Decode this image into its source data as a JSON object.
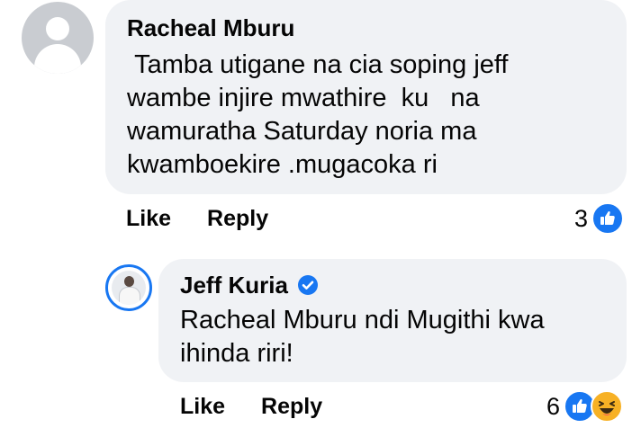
{
  "comments": [
    {
      "author": "Racheal Mburu",
      "text": " Tamba utigane na cia soping jeff\nwambe injire mwathire  ku   na\nwamuratha Saturday noria ma\nkwamboekire .mugacoka ri",
      "actions": {
        "like": "Like",
        "reply": "Reply"
      },
      "reactions": {
        "count": "3",
        "types": [
          "like-icon"
        ]
      }
    },
    {
      "author": "Jeff Kuria",
      "verified": true,
      "text": "Racheal Mburu ndi Mugithi kwa\nihinda riri!",
      "actions": {
        "like": "Like",
        "reply": "Reply"
      },
      "reactions": {
        "count": "6",
        "types": [
          "like-icon",
          "haha-icon"
        ]
      }
    }
  ],
  "colors": {
    "bubble": "#f0f2f5",
    "like_blue": "#1877f2",
    "haha_yellow": "#f7b125",
    "text": "#050505"
  }
}
